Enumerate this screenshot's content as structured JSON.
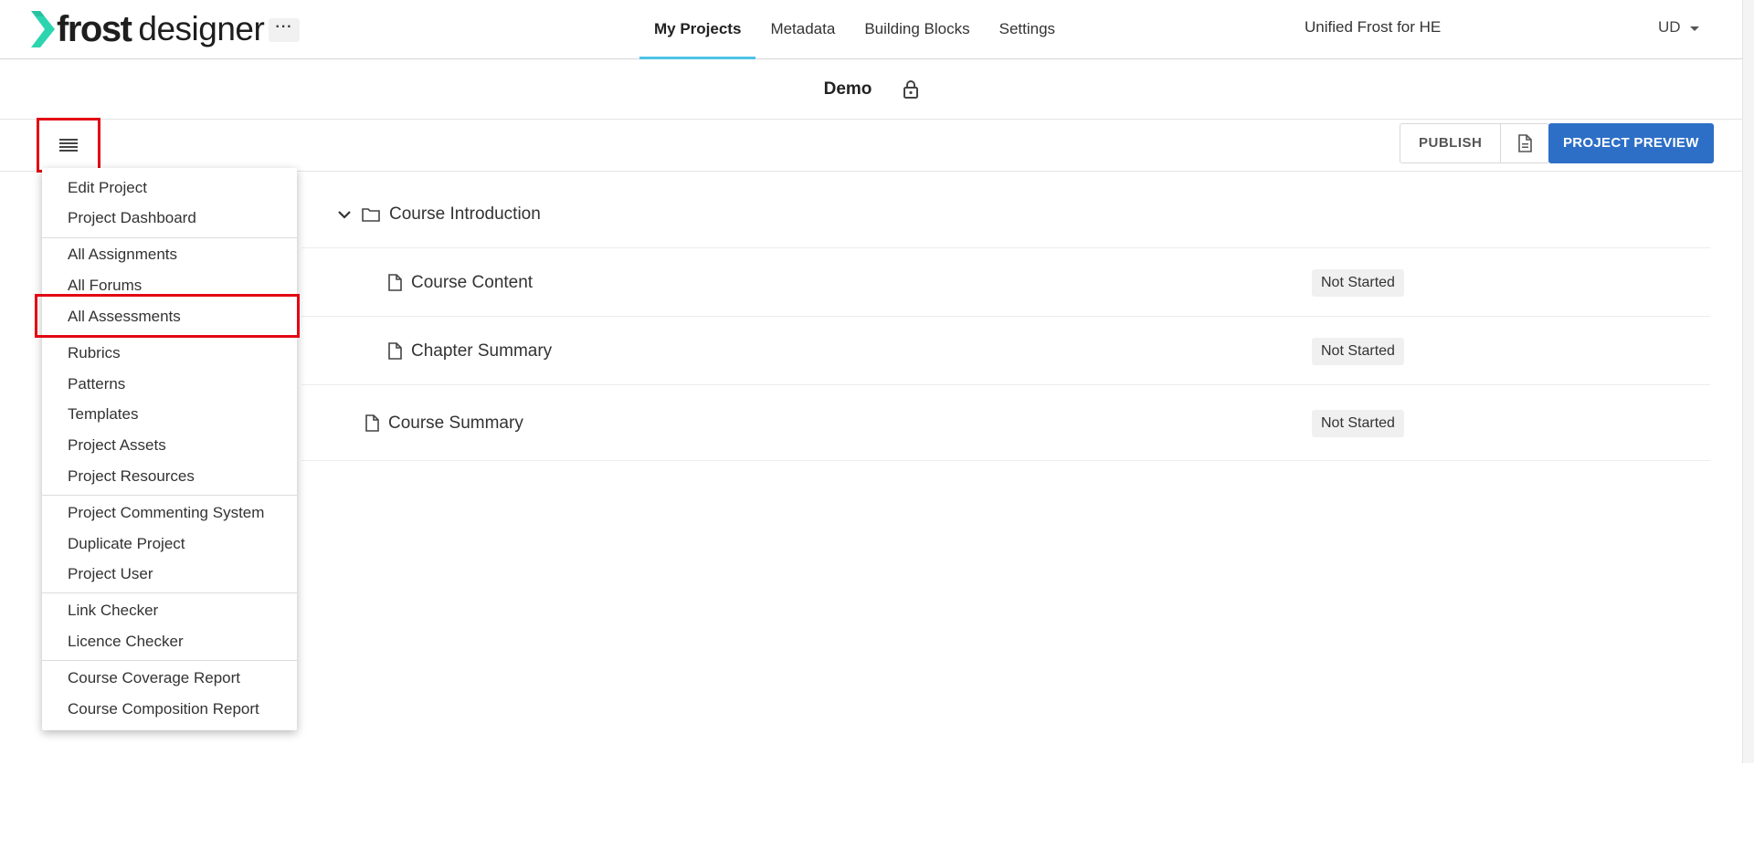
{
  "brand": {
    "logo_frost": "frost",
    "logo_designer": "designer",
    "logo_mark_color": "#2dd4b0",
    "more_label": "···"
  },
  "nav": {
    "items": [
      {
        "label": "My Projects",
        "active": true
      },
      {
        "label": "Metadata",
        "active": false
      },
      {
        "label": "Building Blocks",
        "active": false
      },
      {
        "label": "Settings",
        "active": false
      }
    ],
    "active_underline_color": "#4fc3e8"
  },
  "header": {
    "org_name": "Unified Frost for HE",
    "user_initials": "UD"
  },
  "project": {
    "title": "Demo",
    "lock_icon": "lock-icon"
  },
  "toolbar": {
    "menu_icon": "hamburger-menu-icon",
    "publish_label": "PUBLISH",
    "doc_icon": "document-icon",
    "preview_label": "PROJECT PREVIEW",
    "preview_color": "#2d6fc6"
  },
  "menu": {
    "items": [
      "Edit Project",
      "Project Dashboard",
      "All Assignments",
      "All Forums",
      "All Assessments",
      "Rubrics",
      "Patterns",
      "Templates",
      "Project Assets",
      "Project Resources",
      "Project Commenting System",
      "Duplicate Project",
      "Project User",
      "Link Checker",
      "Licence Checker",
      "Course Coverage Report",
      "Course Composition Report"
    ],
    "highlighted": "All Assessments",
    "highlight_color": "#e30613"
  },
  "tree": {
    "items": [
      {
        "label": "Course Introduction",
        "type": "folder",
        "expanded": true,
        "status": ""
      },
      {
        "label": "Course Content",
        "type": "page",
        "status": "Not Started"
      },
      {
        "label": "Chapter Summary",
        "type": "page",
        "status": "Not Started"
      },
      {
        "label": "Course Summary",
        "type": "page",
        "status": "Not Started"
      }
    ]
  }
}
